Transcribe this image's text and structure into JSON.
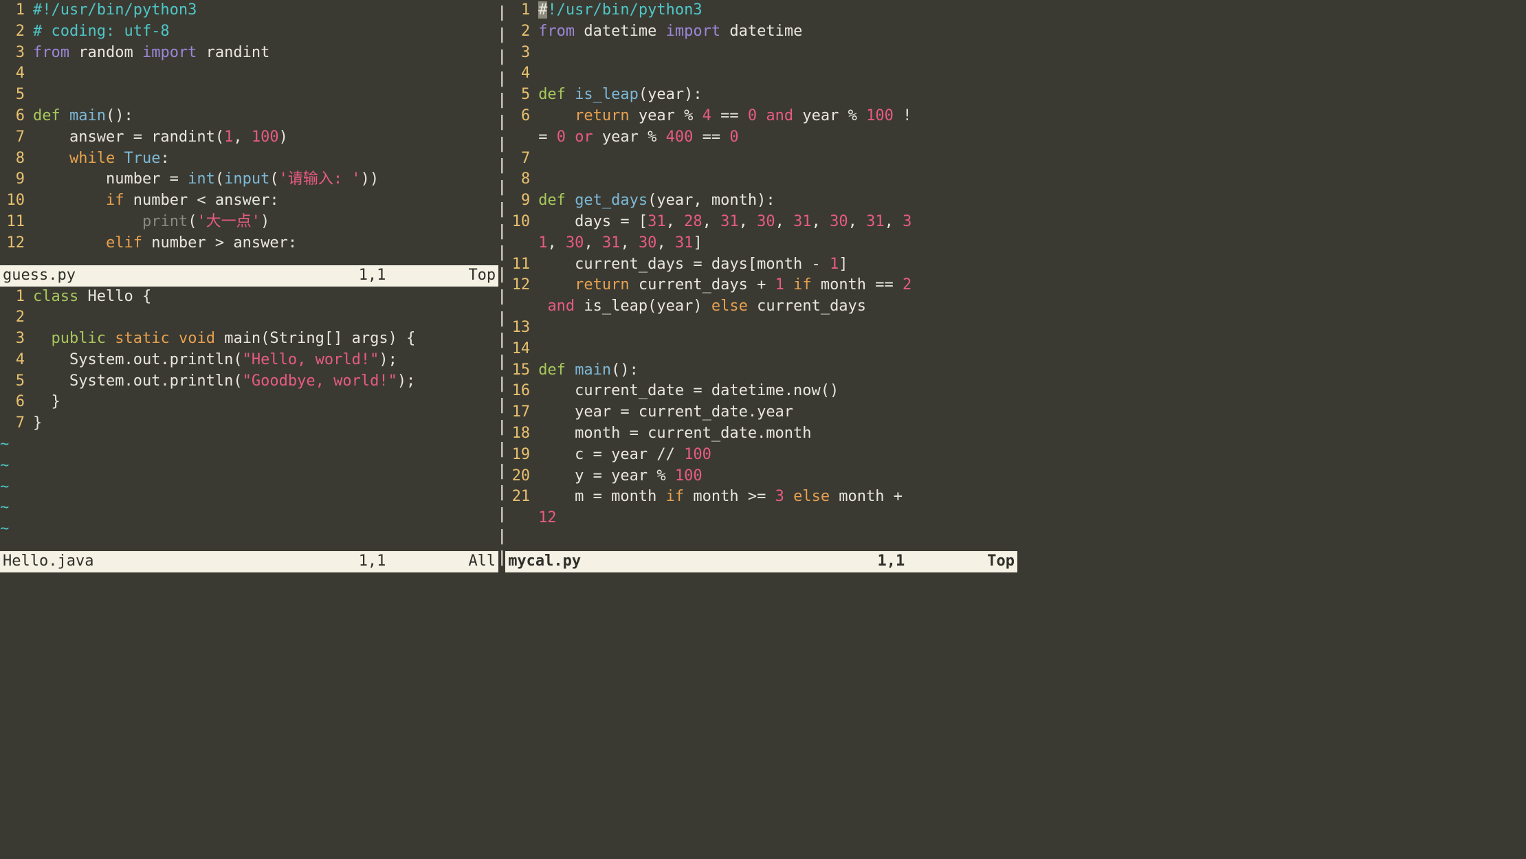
{
  "panes": {
    "topleft": {
      "filename": "guess.py",
      "cursor": "1,1",
      "scroll": "Top",
      "lines": [
        {
          "n": 1,
          "tokens": [
            {
              "t": "#!/usr/bin/python3",
              "c": "c-comment"
            }
          ]
        },
        {
          "n": 2,
          "tokens": [
            {
              "t": "# coding: utf-8",
              "c": "c-comment"
            }
          ]
        },
        {
          "n": 3,
          "tokens": [
            {
              "t": "from",
              "c": "c-keyword"
            },
            {
              "t": " random "
            },
            {
              "t": "import",
              "c": "c-keyword"
            },
            {
              "t": " randint"
            }
          ]
        },
        {
          "n": 4,
          "tokens": []
        },
        {
          "n": 5,
          "tokens": []
        },
        {
          "n": 6,
          "tokens": [
            {
              "t": "def",
              "c": "c-def"
            },
            {
              "t": " "
            },
            {
              "t": "main",
              "c": "c-func"
            },
            {
              "t": "():"
            }
          ]
        },
        {
          "n": 7,
          "tokens": [
            {
              "t": "    answer = randint("
            },
            {
              "t": "1",
              "c": "c-number"
            },
            {
              "t": ", "
            },
            {
              "t": "100",
              "c": "c-number"
            },
            {
              "t": ")"
            }
          ]
        },
        {
          "n": 8,
          "tokens": [
            {
              "t": "    "
            },
            {
              "t": "while",
              "c": "c-bool"
            },
            {
              "t": " "
            },
            {
              "t": "True",
              "c": "c-builtin"
            },
            {
              "t": ":"
            }
          ]
        },
        {
          "n": 9,
          "tokens": [
            {
              "t": "        number = "
            },
            {
              "t": "int",
              "c": "c-builtin"
            },
            {
              "t": "("
            },
            {
              "t": "input",
              "c": "c-builtin"
            },
            {
              "t": "("
            },
            {
              "t": "'请输入: '",
              "c": "c-string"
            },
            {
              "t": "))"
            }
          ]
        },
        {
          "n": 10,
          "tokens": [
            {
              "t": "        "
            },
            {
              "t": "if",
              "c": "c-bool"
            },
            {
              "t": " number < answer:"
            }
          ]
        },
        {
          "n": 11,
          "tokens": [
            {
              "t": "            "
            },
            {
              "t": "print",
              "c": "c-print"
            },
            {
              "t": "("
            },
            {
              "t": "'大一点'",
              "c": "c-string"
            },
            {
              "t": ")"
            }
          ]
        },
        {
          "n": 12,
          "tokens": [
            {
              "t": "        "
            },
            {
              "t": "elif",
              "c": "c-bool"
            },
            {
              "t": " number > answer:"
            }
          ]
        }
      ]
    },
    "bottomleft": {
      "filename": "Hello.java",
      "cursor": "1,1",
      "scroll": "All",
      "lines": [
        {
          "n": 1,
          "tokens": [
            {
              "t": "class",
              "c": "c-def"
            },
            {
              "t": " Hello {"
            }
          ]
        },
        {
          "n": 2,
          "tokens": []
        },
        {
          "n": 3,
          "tokens": [
            {
              "t": "  "
            },
            {
              "t": "public",
              "c": "c-def"
            },
            {
              "t": " "
            },
            {
              "t": "static",
              "c": "c-type"
            },
            {
              "t": " "
            },
            {
              "t": "void",
              "c": "c-type"
            },
            {
              "t": " main(String[] args) {"
            }
          ]
        },
        {
          "n": 4,
          "tokens": [
            {
              "t": "    System.out.println("
            },
            {
              "t": "\"Hello, world!\"",
              "c": "c-string"
            },
            {
              "t": ");"
            }
          ]
        },
        {
          "n": 5,
          "tokens": [
            {
              "t": "    System.out.println("
            },
            {
              "t": "\"Goodbye, world!\"",
              "c": "c-string"
            },
            {
              "t": ");"
            }
          ]
        },
        {
          "n": 6,
          "tokens": [
            {
              "t": "  }"
            }
          ]
        },
        {
          "n": 7,
          "tokens": [
            {
              "t": "}"
            }
          ]
        }
      ],
      "tildes": 5
    },
    "right": {
      "filename": "mycal.py",
      "cursor": "1,1",
      "scroll": "Top",
      "active": true,
      "lines": [
        {
          "n": 1,
          "tokens": [
            {
              "t": "#",
              "c": "cursor"
            },
            {
              "t": "!/usr/bin/python3",
              "c": "c-comment"
            }
          ]
        },
        {
          "n": 2,
          "tokens": [
            {
              "t": "from",
              "c": "c-keyword"
            },
            {
              "t": " datetime "
            },
            {
              "t": "import",
              "c": "c-keyword"
            },
            {
              "t": " datetime"
            }
          ]
        },
        {
          "n": 3,
          "tokens": []
        },
        {
          "n": 4,
          "tokens": []
        },
        {
          "n": 5,
          "tokens": [
            {
              "t": "def",
              "c": "c-def"
            },
            {
              "t": " "
            },
            {
              "t": "is_leap",
              "c": "c-func"
            },
            {
              "t": "(year):"
            }
          ]
        },
        {
          "n": 6,
          "tokens": [
            {
              "t": "    "
            },
            {
              "t": "return",
              "c": "c-bool"
            },
            {
              "t": " year % "
            },
            {
              "t": "4",
              "c": "c-number"
            },
            {
              "t": " == "
            },
            {
              "t": "0",
              "c": "c-number"
            },
            {
              "t": " "
            },
            {
              "t": "and",
              "c": "c-logic"
            },
            {
              "t": " year % "
            },
            {
              "t": "100",
              "c": "c-number"
            },
            {
              "t": " !"
            }
          ]
        },
        {
          "wrap": true,
          "tokens": [
            {
              "t": "= "
            },
            {
              "t": "0",
              "c": "c-number"
            },
            {
              "t": " "
            },
            {
              "t": "or",
              "c": "c-logic"
            },
            {
              "t": " year % "
            },
            {
              "t": "400",
              "c": "c-number"
            },
            {
              "t": " == "
            },
            {
              "t": "0",
              "c": "c-number"
            }
          ]
        },
        {
          "n": 7,
          "tokens": []
        },
        {
          "n": 8,
          "tokens": []
        },
        {
          "n": 9,
          "tokens": [
            {
              "t": "def",
              "c": "c-def"
            },
            {
              "t": " "
            },
            {
              "t": "get_days",
              "c": "c-func"
            },
            {
              "t": "(year, month):"
            }
          ]
        },
        {
          "n": 10,
          "tokens": [
            {
              "t": "    days = ["
            },
            {
              "t": "31",
              "c": "c-number"
            },
            {
              "t": ", "
            },
            {
              "t": "28",
              "c": "c-number"
            },
            {
              "t": ", "
            },
            {
              "t": "31",
              "c": "c-number"
            },
            {
              "t": ", "
            },
            {
              "t": "30",
              "c": "c-number"
            },
            {
              "t": ", "
            },
            {
              "t": "31",
              "c": "c-number"
            },
            {
              "t": ", "
            },
            {
              "t": "30",
              "c": "c-number"
            },
            {
              "t": ", "
            },
            {
              "t": "31",
              "c": "c-number"
            },
            {
              "t": ", "
            },
            {
              "t": "3",
              "c": "c-number"
            }
          ]
        },
        {
          "wrap": true,
          "tokens": [
            {
              "t": "1",
              "c": "c-number"
            },
            {
              "t": ", "
            },
            {
              "t": "30",
              "c": "c-number"
            },
            {
              "t": ", "
            },
            {
              "t": "31",
              "c": "c-number"
            },
            {
              "t": ", "
            },
            {
              "t": "30",
              "c": "c-number"
            },
            {
              "t": ", "
            },
            {
              "t": "31",
              "c": "c-number"
            },
            {
              "t": "]"
            }
          ]
        },
        {
          "n": 11,
          "tokens": [
            {
              "t": "    current_days = days[month - "
            },
            {
              "t": "1",
              "c": "c-number"
            },
            {
              "t": "]"
            }
          ]
        },
        {
          "n": 12,
          "tokens": [
            {
              "t": "    "
            },
            {
              "t": "return",
              "c": "c-bool"
            },
            {
              "t": " current_days + "
            },
            {
              "t": "1",
              "c": "c-number"
            },
            {
              "t": " "
            },
            {
              "t": "if",
              "c": "c-bool"
            },
            {
              "t": " month == "
            },
            {
              "t": "2",
              "c": "c-number"
            }
          ]
        },
        {
          "wrap": true,
          "tokens": [
            {
              "t": " "
            },
            {
              "t": "and",
              "c": "c-logic"
            },
            {
              "t": " is_leap(year) "
            },
            {
              "t": "else",
              "c": "c-bool"
            },
            {
              "t": " current_days"
            }
          ]
        },
        {
          "n": 13,
          "tokens": []
        },
        {
          "n": 14,
          "tokens": []
        },
        {
          "n": 15,
          "tokens": [
            {
              "t": "def",
              "c": "c-def"
            },
            {
              "t": " "
            },
            {
              "t": "main",
              "c": "c-func"
            },
            {
              "t": "():"
            }
          ]
        },
        {
          "n": 16,
          "tokens": [
            {
              "t": "    current_date = datetime.now()"
            }
          ]
        },
        {
          "n": 17,
          "tokens": [
            {
              "t": "    year = current_date.year"
            }
          ]
        },
        {
          "n": 18,
          "tokens": [
            {
              "t": "    month = current_date.month"
            }
          ]
        },
        {
          "n": 19,
          "tokens": [
            {
              "t": "    c = year // "
            },
            {
              "t": "100",
              "c": "c-number"
            }
          ]
        },
        {
          "n": 20,
          "tokens": [
            {
              "t": "    y = year % "
            },
            {
              "t": "100",
              "c": "c-number"
            }
          ]
        },
        {
          "n": 21,
          "tokens": [
            {
              "t": "    m = month "
            },
            {
              "t": "if",
              "c": "c-bool"
            },
            {
              "t": " month >= "
            },
            {
              "t": "3",
              "c": "c-number"
            },
            {
              "t": " "
            },
            {
              "t": "else",
              "c": "c-bool"
            },
            {
              "t": " month + "
            }
          ]
        },
        {
          "wrap": true,
          "tokens": [
            {
              "t": "12",
              "c": "c-number"
            }
          ]
        }
      ]
    }
  }
}
